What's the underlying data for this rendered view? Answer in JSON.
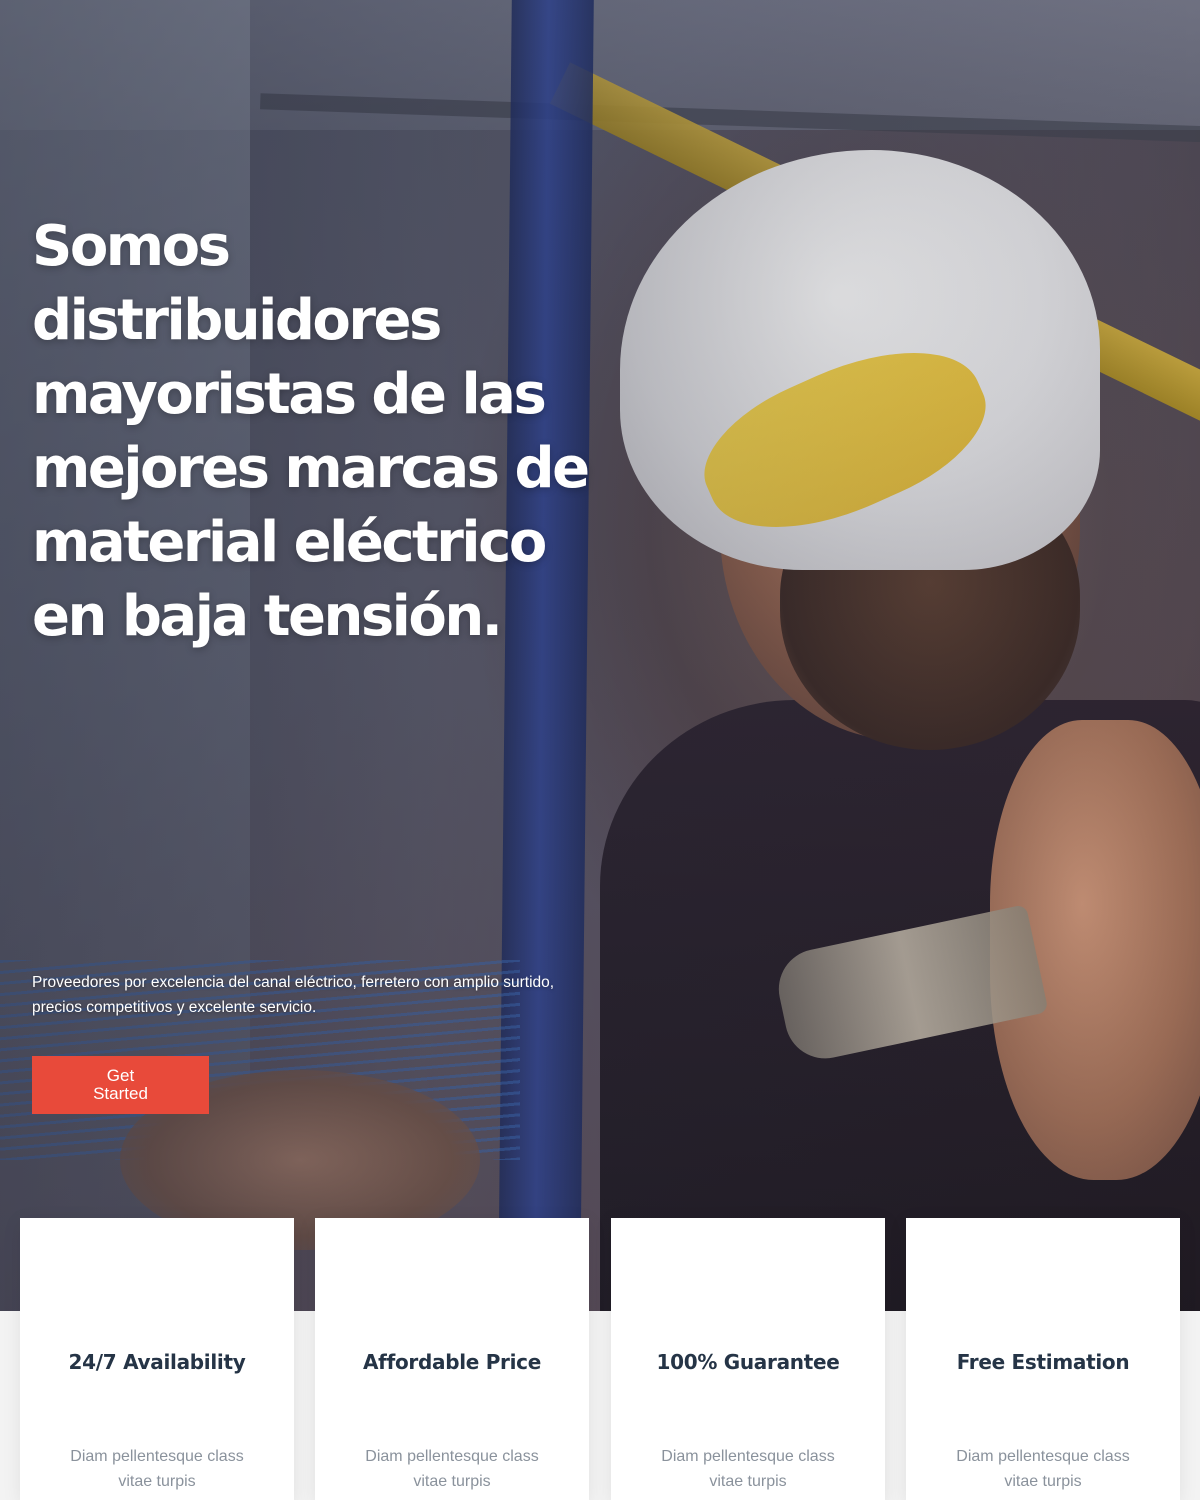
{
  "hero": {
    "headline": "Somos distribuidores mayoristas de las mejores marcas de material eléctrico en baja tensión.",
    "subtext": "Proveedores por excelencia del canal eléctrico, ferretero con amplio surtido, precios competitivos y excelente servicio.",
    "cta_label": "Get Started"
  },
  "features": [
    {
      "title": "24/7 Availability",
      "text": "Diam pellentesque class vitae turpis"
    },
    {
      "title": "Affordable Price",
      "text": "Diam pellentesque class vitae turpis"
    },
    {
      "title": "100% Guarantee",
      "text": "Diam pellentesque class vitae turpis"
    },
    {
      "title": "Free Estimation",
      "text": "Diam pellentesque class vitae turpis"
    }
  ],
  "colors": {
    "cta": "#e84a3a",
    "card_title": "#253446",
    "card_text": "#8a929c"
  }
}
